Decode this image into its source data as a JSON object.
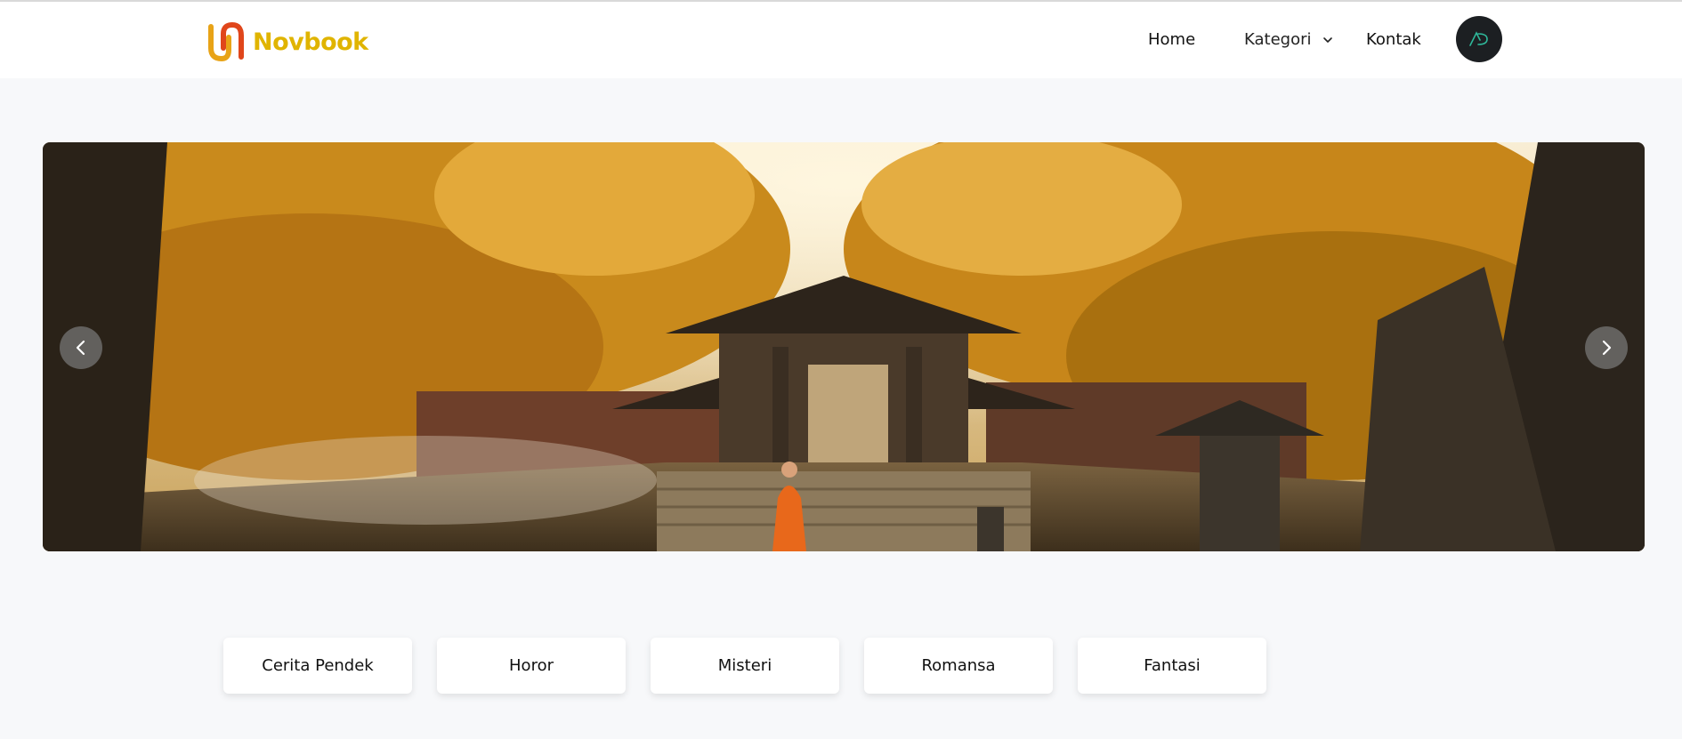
{
  "brand": {
    "name": "Novbook",
    "color": "#e0b400"
  },
  "nav": {
    "home": "Home",
    "kategori": "Kategori",
    "kontak": "Kontak"
  },
  "carousel": {
    "slide_description": "",
    "prev_icon": "chevron-left-icon",
    "next_icon": "chevron-right-icon"
  },
  "categories": [
    {
      "label": "Cerita Pendek"
    },
    {
      "label": "Horor"
    },
    {
      "label": "Misteri"
    },
    {
      "label": "Romansa"
    },
    {
      "label": "Fantasi"
    }
  ]
}
